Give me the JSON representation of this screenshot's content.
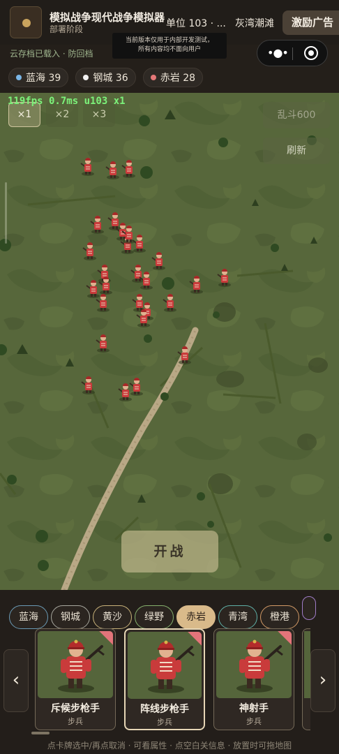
{
  "header": {
    "title": "模拟战争现代战争模拟器",
    "phase": "部署阶段",
    "unit_count": "单位 103 · ...",
    "region": "灰湾潮滩",
    "ad_button": "激励广告",
    "notice_line1": "当前版本仅用于内部开发测试，",
    "notice_line2": "所有内容均不面向用户",
    "save_status": "云存档已载入 · 防回档"
  },
  "factions": [
    {
      "name": "蓝海",
      "count": "39",
      "color": "#7ab6e6"
    },
    {
      "name": "钢城",
      "count": "36",
      "color": "#f1f1f1"
    },
    {
      "name": "赤岩",
      "count": "28",
      "color": "#e57878"
    }
  ],
  "map": {
    "debug_text": "119fps 0.7ms u103 x1",
    "speed_options": [
      "×1",
      "×2",
      "×3"
    ],
    "active_speed": "×1",
    "brawl_button": "乱斗600",
    "refresh_button": "刷新",
    "start_button": "开战",
    "terrain_color": "#56663a",
    "unit_color": "#c93b3b"
  },
  "faction_tabs": [
    {
      "label": "蓝海",
      "style": "t-blue"
    },
    {
      "label": "钢城",
      "style": "t-steel"
    },
    {
      "label": "黄沙",
      "style": "t-sand"
    },
    {
      "label": "绿野",
      "style": "t-green"
    },
    {
      "label": "赤岩",
      "style": "active"
    },
    {
      "label": "青湾",
      "style": "t-teal"
    },
    {
      "label": "橙港",
      "style": "t-orange"
    },
    {
      "label": "",
      "style": "t-purple"
    }
  ],
  "cards": [
    {
      "name": "斥候步枪手",
      "type": "步兵"
    },
    {
      "name": "阵线步枪手",
      "type": "步兵"
    },
    {
      "name": "神射手",
      "type": "步兵"
    }
  ],
  "selected_card": "阵线步枪手",
  "nav": {
    "prev": "‹",
    "next": "›"
  },
  "hint": "点卡牌选中/再点取消 · 可看属性 · 点空白关信息 · 放置时可拖地图"
}
